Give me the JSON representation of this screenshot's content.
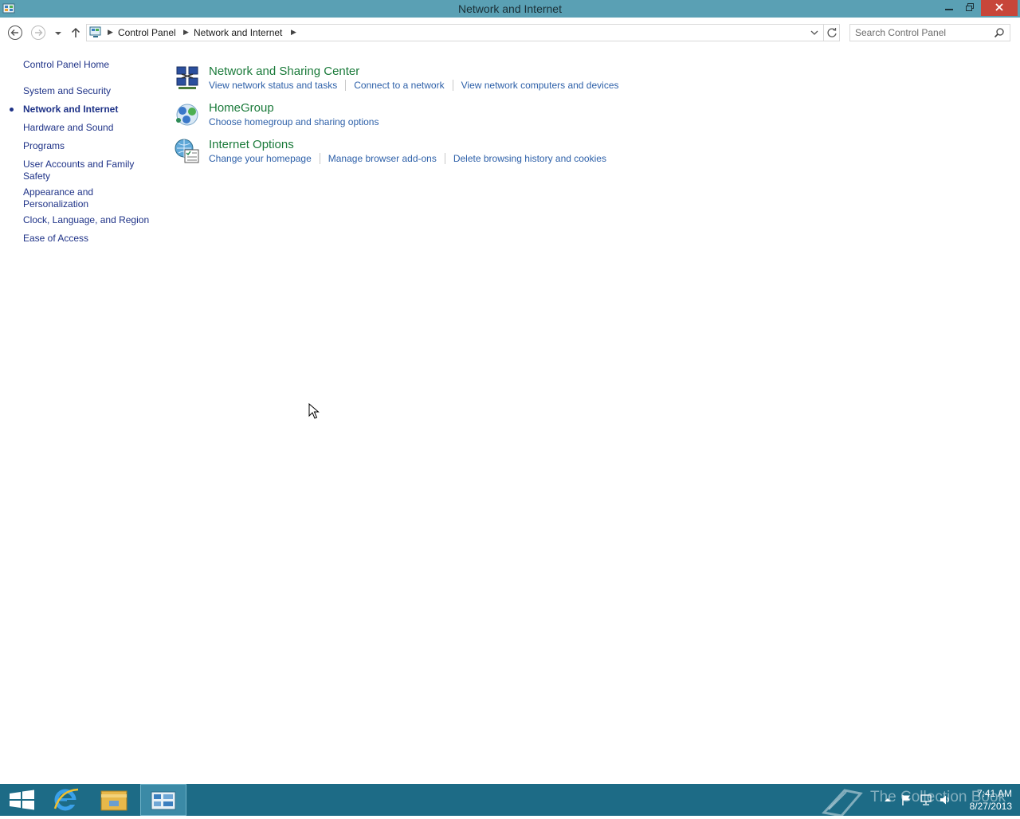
{
  "window": {
    "title": "Network and Internet"
  },
  "address": {
    "breadcrumbs": [
      "Control Panel",
      "Network and Internet"
    ],
    "search_placeholder": "Search Control Panel"
  },
  "sidebar": {
    "home": "Control Panel Home",
    "items": [
      {
        "label": "System and Security",
        "active": false
      },
      {
        "label": "Network and Internet",
        "active": true
      },
      {
        "label": "Hardware and Sound",
        "active": false
      },
      {
        "label": "Programs",
        "active": false
      },
      {
        "label": "User Accounts and Family Safety",
        "active": false
      },
      {
        "label": "Appearance and Personalization",
        "active": false
      },
      {
        "label": "Clock, Language, and Region",
        "active": false
      },
      {
        "label": "Ease of Access",
        "active": false
      }
    ]
  },
  "categories": [
    {
      "title": "Network and Sharing Center",
      "icon": "network-sharing-center-icon",
      "links": [
        "View network status and tasks",
        "Connect to a network",
        "View network computers and devices"
      ]
    },
    {
      "title": "HomeGroup",
      "icon": "homegroup-icon",
      "links": [
        "Choose homegroup and sharing options"
      ]
    },
    {
      "title": "Internet Options",
      "icon": "internet-options-icon",
      "links": [
        "Change your homepage",
        "Manage browser add-ons",
        "Delete browsing history and cookies"
      ]
    }
  ],
  "taskbar": {
    "apps": [
      "start-icon",
      "internet-explorer-icon",
      "file-explorer-icon",
      "control-panel-icon"
    ],
    "active_app": "control-panel-icon",
    "watermark": "The Collection Book",
    "time": "7:41 AM",
    "date": "8/27/2013"
  },
  "colors": {
    "titlebar": "#5aa0b4",
    "taskbar": "#1d6b86",
    "category_title": "#1a7a3a",
    "link": "#2c5fa8",
    "nav_link": "#1e3287"
  }
}
